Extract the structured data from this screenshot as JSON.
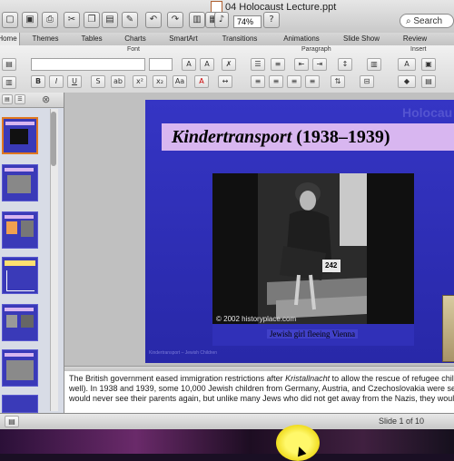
{
  "window": {
    "title": "04 Holocaust Lecture.ppt",
    "zoom": "74%",
    "search_placeholder": "Search"
  },
  "ribbon": {
    "tabs": [
      "Home",
      "Themes",
      "Tables",
      "Charts",
      "SmartArt",
      "Transitions",
      "Animations",
      "Slide Show",
      "Review"
    ],
    "active_tab": "Home",
    "groups": [
      "Font",
      "Paragraph",
      "Insert"
    ]
  },
  "slide": {
    "title_italic": "Kindertransport",
    "title_years": "(1938–1939)",
    "corner_text": "Holocau",
    "photo_credit": "© 2002 historyplace.com",
    "caption": "Jewish girl fleeing Vienna",
    "tag_number": "242",
    "footer_link": "Kindertransport – Jewish Children"
  },
  "notes": {
    "line1_before": "The British government eased immigration restrictions after ",
    "line1_italic": "Kristallnacht",
    "line1_after": " to allow the rescue of refugee children",
    "line2": "well). In 1938 and 1939, some 10,000 Jewish children from Germany, Austria, and Czechoslovakia were sent t",
    "line3": "would never see their parents again, but unlike many Jews who did not get away from the Nazis, they would sur"
  },
  "status": {
    "slide_indicator": "Slide 1 of 10"
  },
  "colors": {
    "slide_bg": "#3030b8",
    "title_box": "#d8b6f0",
    "selected_thumb": "#e07820"
  }
}
